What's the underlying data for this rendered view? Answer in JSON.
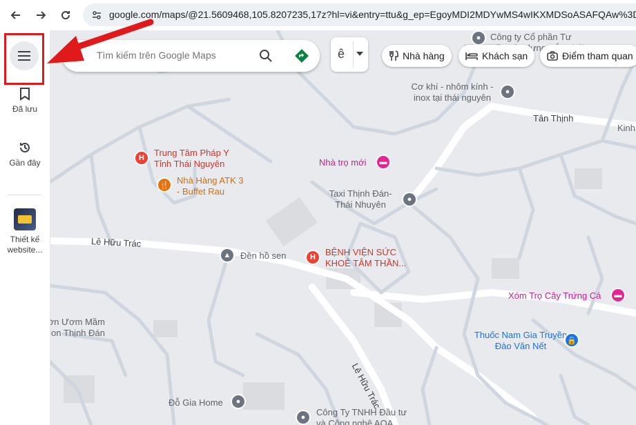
{
  "browser": {
    "url": "google.com/maps/@21.5609468,105.8207235,17z?hl=vi&entry=ttu&g_ep=EgoyMDI2MDYwMS4wIKXMDSoASAFQAw%3D%3D"
  },
  "sidebar": {
    "saved_label": "Đã lưu",
    "recent_label": "Gần đây",
    "app_label": "Thiết kế website..."
  },
  "search": {
    "placeholder": "Tìm kiếm trên Google Maps",
    "layer_label": "ê"
  },
  "chips": [
    {
      "label": "Nhà hàng",
      "icon": "restaurant-icon"
    },
    {
      "label": "Khách sạn",
      "icon": "hotel-icon"
    },
    {
      "label": "Điểm tham quan",
      "icon": "camera-icon"
    }
  ],
  "places": {
    "cong_ty_co_phan": "Công ty Cổ phần Tư vấn Xây dựng Bắc Thái",
    "co_khi": "Cơ khí - nhôm kính - inox tại thái nguyên",
    "trung_tam_phap_y": "Trung Tâm Pháp Y Tỉnh Thái Nguyên",
    "nha_hang_atk": "Nhà Hàng ATK 3 - Buffet Rau",
    "nha_tro_moi": "Nhà trọ mới",
    "taxi": "Taxi Thịnh Đán-Thái Nhuyên",
    "den_ho_sen": "Đền hồ sen",
    "benh_vien": "BỆNH VIỆN SỨC KHOẺ TÂM THẦN...",
    "xom_tro": "Xóm Trọ Cây Trứng Cá",
    "thuoc_nam": "Thuốc Nam Gia Truyền Đào Văn Nết",
    "vuon_mam": "Vườn Ươm Mầm Non Thịnh Đán",
    "do_gia_home": "Đỗ Gia Home",
    "cong_ty_tnhh": "Công Ty TNHH Đầu tư và Công nghệ AOA",
    "kinh": "Kinh"
  },
  "roads": {
    "tan_thinh": "Tân Thịnh",
    "le_huu_trac_1": "Lê Hữu Trác",
    "le_huu_trac_2": "Lê Hữu Trác"
  },
  "colors": {
    "annotation_arrow": "#e0191b",
    "poi_red": "#d93025",
    "poi_orange": "#d56e0c",
    "poi_pink": "#c5218c",
    "poi_blue": "#1a73e8"
  }
}
